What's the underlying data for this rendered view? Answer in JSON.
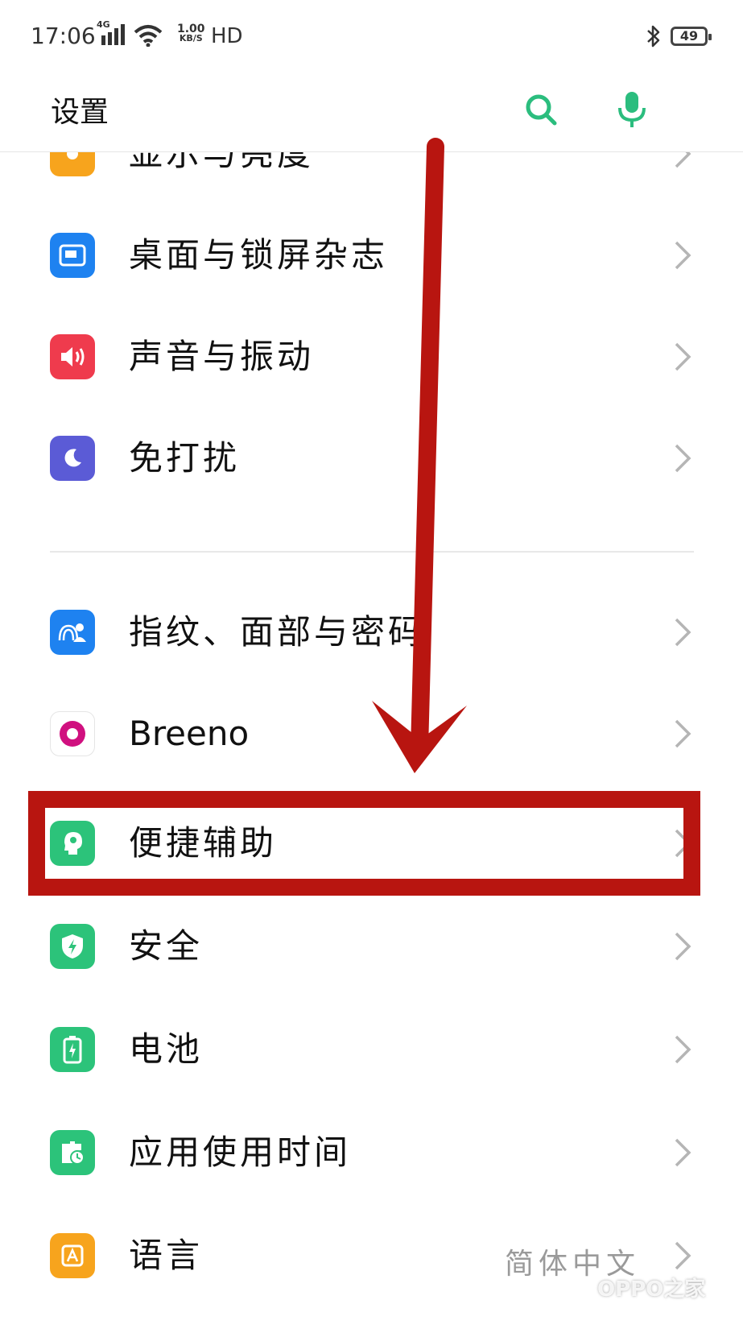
{
  "status_bar": {
    "time": "17:06",
    "network": "4G",
    "speed_value": "1.00",
    "speed_unit": "KB/S",
    "hd": "HD",
    "battery": "49"
  },
  "header": {
    "title": "设置",
    "search_icon": "search-icon",
    "mic_icon": "mic-icon",
    "accent_color": "#2bbd7e"
  },
  "items": [
    {
      "label": "显示与亮度",
      "icon": "brightness-icon",
      "color": "#f7a41d"
    },
    {
      "label": "桌面与锁屏杂志",
      "icon": "wallpaper-icon",
      "color": "#1e82f0"
    },
    {
      "label": "声音与振动",
      "icon": "speaker-icon",
      "color": "#ef3b4d"
    },
    {
      "label": "免打扰",
      "icon": "moon-icon",
      "color": "#5b5bd6"
    },
    {
      "label": "指纹、面部与密码",
      "icon": "fingerprint-face-icon",
      "color": "#1e82f0"
    },
    {
      "label": "Breeno",
      "icon": "breeno-icon",
      "color": "#d0107f"
    },
    {
      "label": "便捷辅助",
      "icon": "assist-head-icon",
      "color": "#2cc37a"
    },
    {
      "label": "安全",
      "icon": "shield-icon",
      "color": "#2cc37a"
    },
    {
      "label": "电池",
      "icon": "battery-icon",
      "color": "#2cc37a"
    },
    {
      "label": "应用使用时间",
      "icon": "app-time-icon",
      "color": "#2cc37a"
    },
    {
      "label": "语言",
      "value": "简体中文",
      "icon": "language-icon",
      "color": "#f7a41d"
    }
  ],
  "annotation": {
    "highlight_color": "#b81510",
    "highlighted_item": "便捷辅助"
  },
  "watermark": "OPPO之家"
}
